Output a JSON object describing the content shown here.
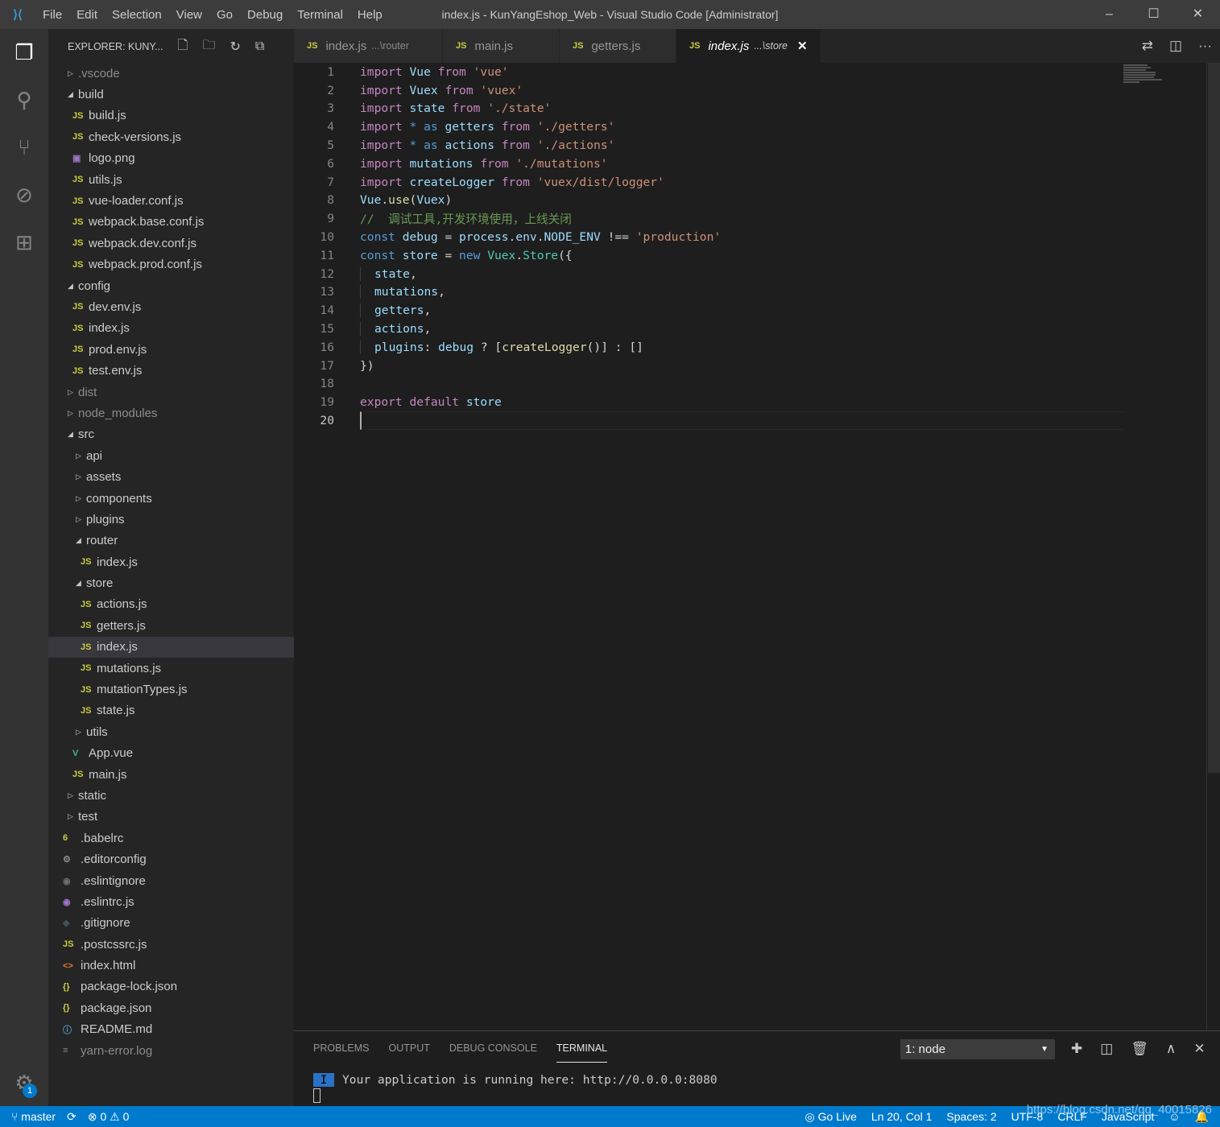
{
  "titlebar": {
    "title": "index.js - KunYangEshop_Web - Visual Studio Code [Administrator]",
    "menu": [
      "File",
      "Edit",
      "Selection",
      "View",
      "Go",
      "Debug",
      "Terminal",
      "Help"
    ]
  },
  "sidebar": {
    "header": "EXPLORER: KUNY...",
    "tree": [
      {
        "d": 0,
        "t": "folder",
        "open": false,
        "name": ".vscode",
        "muted": true
      },
      {
        "d": 0,
        "t": "folder",
        "open": true,
        "name": "build"
      },
      {
        "d": 1,
        "t": "js",
        "name": "build.js"
      },
      {
        "d": 1,
        "t": "js",
        "name": "check-versions.js"
      },
      {
        "d": 1,
        "t": "img",
        "name": "logo.png"
      },
      {
        "d": 1,
        "t": "js",
        "name": "utils.js"
      },
      {
        "d": 1,
        "t": "js",
        "name": "vue-loader.conf.js"
      },
      {
        "d": 1,
        "t": "js",
        "name": "webpack.base.conf.js"
      },
      {
        "d": 1,
        "t": "js",
        "name": "webpack.dev.conf.js"
      },
      {
        "d": 1,
        "t": "js",
        "name": "webpack.prod.conf.js"
      },
      {
        "d": 0,
        "t": "folder",
        "open": true,
        "name": "config"
      },
      {
        "d": 1,
        "t": "js",
        "name": "dev.env.js"
      },
      {
        "d": 1,
        "t": "js",
        "name": "index.js"
      },
      {
        "d": 1,
        "t": "js",
        "name": "prod.env.js"
      },
      {
        "d": 1,
        "t": "js",
        "name": "test.env.js"
      },
      {
        "d": 0,
        "t": "folder",
        "open": false,
        "name": "dist",
        "muted": true
      },
      {
        "d": 0,
        "t": "folder",
        "open": false,
        "name": "node_modules",
        "muted": true
      },
      {
        "d": 0,
        "t": "folder",
        "open": true,
        "name": "src"
      },
      {
        "d": 1,
        "t": "folder",
        "open": false,
        "name": "api"
      },
      {
        "d": 1,
        "t": "folder",
        "open": false,
        "name": "assets"
      },
      {
        "d": 1,
        "t": "folder",
        "open": false,
        "name": "components"
      },
      {
        "d": 1,
        "t": "folder",
        "open": false,
        "name": "plugins"
      },
      {
        "d": 1,
        "t": "folder",
        "open": true,
        "name": "router"
      },
      {
        "d": 2,
        "t": "js",
        "name": "index.js"
      },
      {
        "d": 1,
        "t": "folder",
        "open": true,
        "name": "store"
      },
      {
        "d": 2,
        "t": "js",
        "name": "actions.js"
      },
      {
        "d": 2,
        "t": "js",
        "name": "getters.js"
      },
      {
        "d": 2,
        "t": "js",
        "name": "index.js",
        "selected": true
      },
      {
        "d": 2,
        "t": "js",
        "name": "mutations.js"
      },
      {
        "d": 2,
        "t": "js",
        "name": "mutationTypes.js"
      },
      {
        "d": 2,
        "t": "js",
        "name": "state.js"
      },
      {
        "d": 1,
        "t": "folder",
        "open": false,
        "name": "utils"
      },
      {
        "d": 1,
        "t": "vue",
        "name": "App.vue"
      },
      {
        "d": 1,
        "t": "js",
        "name": "main.js"
      },
      {
        "d": 0,
        "t": "folder",
        "open": false,
        "name": "static"
      },
      {
        "d": 0,
        "t": "folder",
        "open": false,
        "name": "test"
      },
      {
        "d": 0,
        "t": "babel",
        "name": ".babelrc"
      },
      {
        "d": 0,
        "t": "gear",
        "name": ".editorconfig"
      },
      {
        "d": 0,
        "t": "eslint-ignore",
        "name": ".eslintignore"
      },
      {
        "d": 0,
        "t": "eslint",
        "name": ".eslintrc.js"
      },
      {
        "d": 0,
        "t": "git",
        "name": ".gitignore"
      },
      {
        "d": 0,
        "t": "js",
        "name": ".postcssrc.js"
      },
      {
        "d": 0,
        "t": "html",
        "name": "index.html"
      },
      {
        "d": 0,
        "t": "json",
        "name": "package-lock.json"
      },
      {
        "d": 0,
        "t": "json",
        "name": "package.json"
      },
      {
        "d": 0,
        "t": "info",
        "name": "README.md"
      },
      {
        "d": 0,
        "t": "log",
        "name": "yarn-error.log",
        "muted": true
      }
    ]
  },
  "tabs": [
    {
      "label": "index.js",
      "desc": "...\\router"
    },
    {
      "label": "main.js",
      "desc": ""
    },
    {
      "label": "getters.js",
      "desc": ""
    },
    {
      "label": "index.js",
      "desc": "...\\store",
      "active": true
    }
  ],
  "editor": {
    "current_line": 20,
    "lines": [
      [
        [
          "kw",
          "import"
        ],
        [
          "pl",
          " "
        ],
        [
          "id",
          "Vue"
        ],
        [
          "pl",
          " "
        ],
        [
          "kw",
          "from"
        ],
        [
          "pl",
          " "
        ],
        [
          "st",
          "'vue'"
        ]
      ],
      [
        [
          "kw",
          "import"
        ],
        [
          "pl",
          " "
        ],
        [
          "id",
          "Vuex"
        ],
        [
          "pl",
          " "
        ],
        [
          "kw",
          "from"
        ],
        [
          "pl",
          " "
        ],
        [
          "st",
          "'vuex'"
        ]
      ],
      [
        [
          "kw",
          "import"
        ],
        [
          "pl",
          " "
        ],
        [
          "id",
          "state"
        ],
        [
          "pl",
          " "
        ],
        [
          "kw",
          "from"
        ],
        [
          "pl",
          " "
        ],
        [
          "st",
          "'./state'"
        ]
      ],
      [
        [
          "kw",
          "import"
        ],
        [
          "pl",
          " "
        ],
        [
          "bl",
          "*"
        ],
        [
          "pl",
          " "
        ],
        [
          "bl",
          "as"
        ],
        [
          "pl",
          " "
        ],
        [
          "id",
          "getters"
        ],
        [
          "pl",
          " "
        ],
        [
          "kw",
          "from"
        ],
        [
          "pl",
          " "
        ],
        [
          "st",
          "'./getters'"
        ]
      ],
      [
        [
          "kw",
          "import"
        ],
        [
          "pl",
          " "
        ],
        [
          "bl",
          "*"
        ],
        [
          "pl",
          " "
        ],
        [
          "bl",
          "as"
        ],
        [
          "pl",
          " "
        ],
        [
          "id",
          "actions"
        ],
        [
          "pl",
          " "
        ],
        [
          "kw",
          "from"
        ],
        [
          "pl",
          " "
        ],
        [
          "st",
          "'./actions'"
        ]
      ],
      [
        [
          "kw",
          "import"
        ],
        [
          "pl",
          " "
        ],
        [
          "id",
          "mutations"
        ],
        [
          "pl",
          " "
        ],
        [
          "kw",
          "from"
        ],
        [
          "pl",
          " "
        ],
        [
          "st",
          "'./mutations'"
        ]
      ],
      [
        [
          "kw",
          "import"
        ],
        [
          "pl",
          " "
        ],
        [
          "id",
          "createLogger"
        ],
        [
          "pl",
          " "
        ],
        [
          "kw",
          "from"
        ],
        [
          "pl",
          " "
        ],
        [
          "st",
          "'vuex/dist/logger'"
        ]
      ],
      [
        [
          "id",
          "Vue"
        ],
        [
          "pl",
          "."
        ],
        [
          "fn",
          "use"
        ],
        [
          "pl",
          "("
        ],
        [
          "id",
          "Vuex"
        ],
        [
          "pl",
          ")"
        ]
      ],
      [
        [
          "cm",
          "//  调试工具,开发环境使用，上线关闭"
        ]
      ],
      [
        [
          "bl",
          "const"
        ],
        [
          "pl",
          " "
        ],
        [
          "id",
          "debug"
        ],
        [
          "pl",
          " = "
        ],
        [
          "id",
          "process"
        ],
        [
          "pl",
          "."
        ],
        [
          "id",
          "env"
        ],
        [
          "pl",
          "."
        ],
        [
          "id",
          "NODE_ENV"
        ],
        [
          "pl",
          " !== "
        ],
        [
          "st",
          "'production'"
        ]
      ],
      [
        [
          "bl",
          "const"
        ],
        [
          "pl",
          " "
        ],
        [
          "id",
          "store"
        ],
        [
          "pl",
          " = "
        ],
        [
          "bl",
          "new"
        ],
        [
          "pl",
          " "
        ],
        [
          "ty",
          "Vuex"
        ],
        [
          "pl",
          "."
        ],
        [
          "ty",
          "Store"
        ],
        [
          "pl",
          "({"
        ]
      ],
      [
        [
          "g",
          ""
        ],
        [
          "id",
          "state"
        ],
        [
          "pl",
          ","
        ]
      ],
      [
        [
          "g",
          ""
        ],
        [
          "id",
          "mutations"
        ],
        [
          "pl",
          ","
        ]
      ],
      [
        [
          "g",
          ""
        ],
        [
          "id",
          "getters"
        ],
        [
          "pl",
          ","
        ]
      ],
      [
        [
          "g",
          ""
        ],
        [
          "id",
          "actions"
        ],
        [
          "pl",
          ","
        ]
      ],
      [
        [
          "g",
          ""
        ],
        [
          "id",
          "plugins"
        ],
        [
          "pl",
          ": "
        ],
        [
          "id",
          "debug"
        ],
        [
          "pl",
          " ? ["
        ],
        [
          "fn",
          "createLogger"
        ],
        [
          "pl",
          "()] : []"
        ]
      ],
      [
        [
          "pl",
          "})"
        ]
      ],
      [],
      [
        [
          "kw",
          "export"
        ],
        [
          "pl",
          " "
        ],
        [
          "kw",
          "default"
        ],
        [
          "pl",
          " "
        ],
        [
          "id",
          "store"
        ]
      ],
      []
    ]
  },
  "panel": {
    "tabs": [
      "PROBLEMS",
      "OUTPUT",
      "DEBUG CONSOLE",
      "TERMINAL"
    ],
    "active_tab": "TERMINAL",
    "terminal_select": "1: node",
    "terminal_cursor": "I",
    "terminal_output": "Your application is running here: http://0.0.0.0:8080"
  },
  "activity": {
    "settings_badge": "1"
  },
  "status": {
    "branch": "master",
    "errors": "0",
    "warnings": "0",
    "go_live": "Go Live",
    "position": "Ln 20, Col 1",
    "spaces": "Spaces: 2",
    "encoding": "UTF-8",
    "eol": "CRLF",
    "language": "JavaScript",
    "watermark": "https://blog.csdn.net/qq_40015826"
  },
  "colors": {
    "accent": "#007acc",
    "activity_bar": "#333333",
    "sidebar": "#252526",
    "editor": "#1e1e1e"
  }
}
